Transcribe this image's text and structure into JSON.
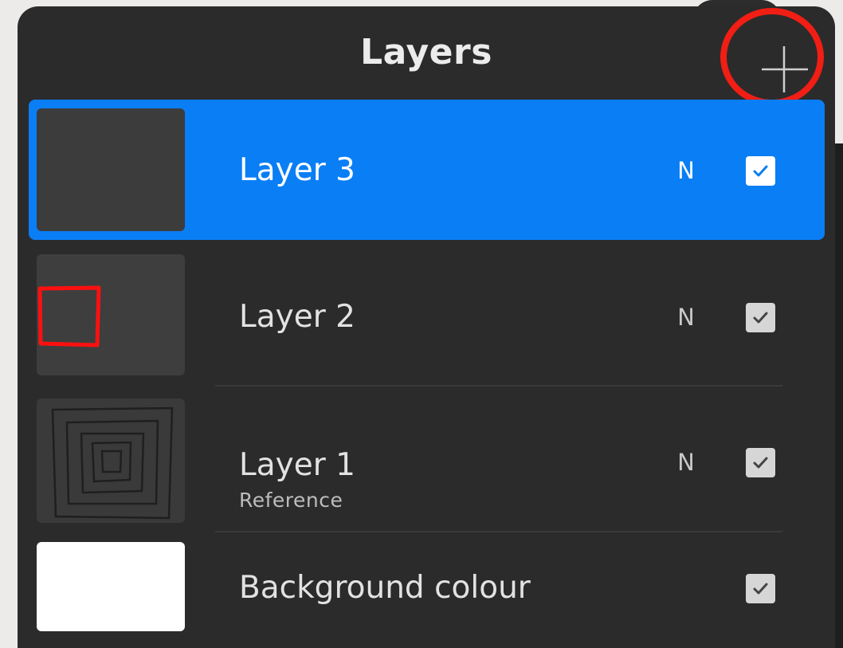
{
  "panel": {
    "title": "Layers",
    "add_button_icon": "plus-icon",
    "annotation_color": "#f01e14"
  },
  "layers": [
    {
      "name": "Layer 3",
      "subtitle": "",
      "blend_mode": "N",
      "visible": true,
      "selected": true
    },
    {
      "name": "Layer 2",
      "subtitle": "",
      "blend_mode": "N",
      "visible": true,
      "selected": false
    },
    {
      "name": "Layer 1",
      "subtitle": "Reference",
      "blend_mode": "N",
      "visible": true,
      "selected": false
    },
    {
      "name": "Background colour",
      "subtitle": "",
      "blend_mode": "",
      "visible": true,
      "selected": false
    }
  ],
  "colors": {
    "panel_bg": "#2b2b2b",
    "selected_row": "#0a7ef5",
    "thumb_dark": "#3c3c3c",
    "background_colour": "#ffffff"
  }
}
